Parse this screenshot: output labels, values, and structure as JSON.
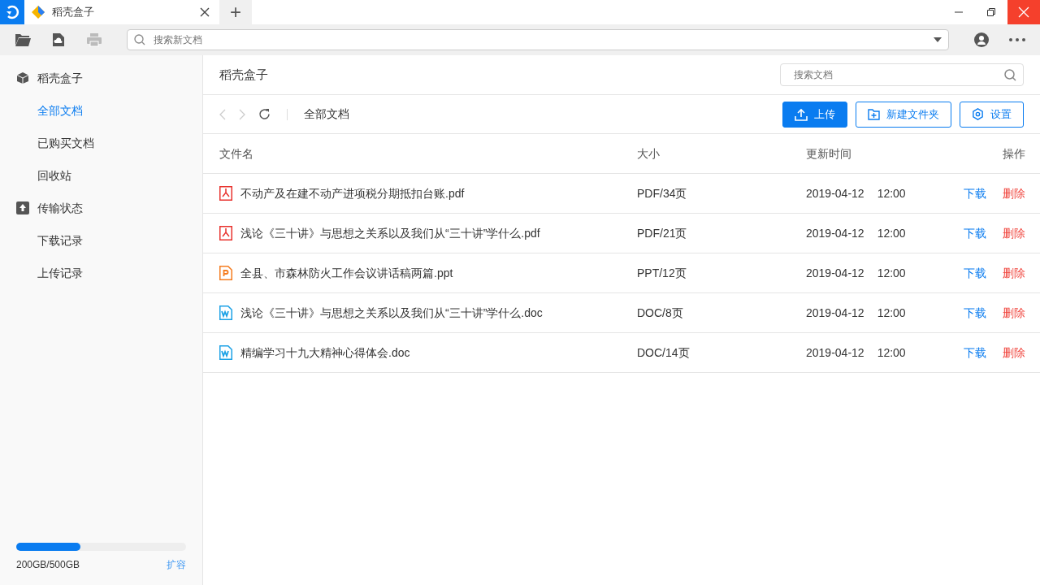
{
  "window": {
    "tab_title": "稻壳盒子",
    "new_tab": "+"
  },
  "toolbar": {
    "search": {
      "placeholder": "搜索新文档"
    }
  },
  "sidebar": {
    "groups": [
      {
        "kind": "box",
        "label": "稻壳盒子",
        "items": [
          {
            "label": "全部文档",
            "selected": true
          },
          {
            "label": "已购买文档",
            "selected": false
          },
          {
            "label": "回收站",
            "selected": false
          }
        ]
      },
      {
        "kind": "transfer",
        "label": "传输状态",
        "items": [
          {
            "label": "下载记录",
            "selected": false
          },
          {
            "label": "上传记录",
            "selected": false
          }
        ]
      }
    ],
    "storage": {
      "level": 0.38,
      "reading": "200GB/500GB",
      "action": "扩容"
    }
  },
  "main": {
    "title": "稻壳盒子",
    "search": {
      "placeholder": "搜索文档"
    },
    "breadcrumb": "全部文档",
    "buttons": [
      {
        "kind": "upload",
        "label": "上传",
        "primary": true
      },
      {
        "kind": "folder",
        "label": "新建文件夹",
        "primary": false
      },
      {
        "kind": "settings",
        "label": "设置",
        "primary": false
      }
    ],
    "table": {
      "columns": [
        "文件名",
        "大小",
        "更新时间",
        "操作"
      ],
      "rows": [
        {
          "kind": "pdf",
          "name": "不动产及在建不动产进项税分期抵扣台账.pdf",
          "size": "PDF/34页",
          "date": "2019-04-12",
          "time": "12:00",
          "download": "下载",
          "delete": "删除"
        },
        {
          "kind": "pdf",
          "name": "浅论《三十讲》与思想之关系以及我们从“三十讲”学什么.pdf",
          "size": "PDF/21页",
          "date": "2019-04-12",
          "time": "12:00",
          "download": "下载",
          "delete": "删除"
        },
        {
          "kind": "ppt",
          "name": "全县、市森林防火工作会议讲话稿两篇.ppt",
          "size": "PPT/12页",
          "date": "2019-04-12",
          "time": "12:00",
          "download": "下载",
          "delete": "删除"
        },
        {
          "kind": "doc",
          "name": "浅论《三十讲》与思想之关系以及我们从“三十讲”学什么.doc",
          "size": "DOC/8页",
          "date": "2019-04-12",
          "time": "12:00",
          "download": "下载",
          "delete": "删除"
        },
        {
          "kind": "doc",
          "name": "精编学习十九大精神心得体会.doc",
          "size": "DOC/14页",
          "date": "2019-04-12",
          "time": "12:00",
          "download": "下载",
          "delete": "删除"
        }
      ]
    }
  }
}
